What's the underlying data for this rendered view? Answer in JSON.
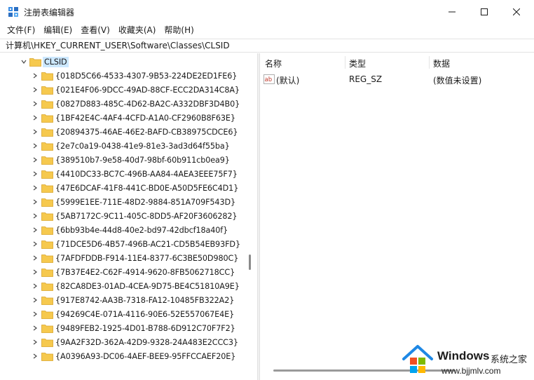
{
  "window": {
    "title": "注册表编辑器",
    "minimize_symbol": "─",
    "maximize_symbol": "☐",
    "close_symbol": "✕"
  },
  "menu": [
    {
      "label": "文件(F)"
    },
    {
      "label": "编辑(E)"
    },
    {
      "label": "查看(V)"
    },
    {
      "label": "收藏夹(A)"
    },
    {
      "label": "帮助(H)"
    }
  ],
  "address": {
    "path": "计算机\\HKEY_CURRENT_USER\\Software\\Classes\\CLSID"
  },
  "tree": {
    "selected": "CLSID",
    "items": [
      "{018D5C66-4533-4307-9B53-224DE2ED1FE6}",
      "{021E4F06-9DCC-49AD-88CF-ECC2DA314C8A}",
      "{0827D883-485C-4D62-BA2C-A332DBF3D4B0}",
      "{1BF42E4C-4AF4-4CFD-A1A0-CF2960B8F63E}",
      "{20894375-46AE-46E2-BAFD-CB38975CDCE6}",
      "{2e7c0a19-0438-41e9-81e3-3ad3d64f55ba}",
      "{389510b7-9e58-40d7-98bf-60b911cb0ea9}",
      "{4410DC33-BC7C-496B-AA84-4AEA3EEE75F7}",
      "{47E6DCAF-41F8-441C-BD0E-A50D5FE6C4D1}",
      "{5999E1EE-711E-48D2-9884-851A709F543D}",
      "{5AB7172C-9C11-405C-8DD5-AF20F3606282}",
      "{6bb93b4e-44d8-40e2-bd97-42dbcf18a40f}",
      "{71DCE5D6-4B57-496B-AC21-CD5B54EB93FD}",
      "{7AFDFDDB-F914-11E4-8377-6C3BE50D980C}",
      "{7B37E4E2-C62F-4914-9620-8FB5062718CC}",
      "{82CA8DE3-01AD-4CEA-9D75-BE4C51810A9E}",
      "{917E8742-AA3B-7318-FA12-10485FB322A2}",
      "{94269C4E-071A-4116-90E6-52E557067E4E}",
      "{9489FEB2-1925-4D01-B788-6D912C70F7F2}",
      "{9AA2F32D-362A-42D9-9328-24A483E2CCC3}",
      "{A0396A93-DC06-4AEF-BEE9-95FFCCAEF20E}"
    ]
  },
  "values": {
    "headers": {
      "name": "名称",
      "type": "类型",
      "data": "数据"
    },
    "rows": [
      {
        "name": "(默认)",
        "type": "REG_SZ",
        "data": "(数值未设置)"
      }
    ]
  },
  "watermark": {
    "brand": "Windows",
    "site_name": "系统之家",
    "url": "www.bjjmlv.com"
  },
  "colors": {
    "folder": "#f6c94e",
    "selection": "#cce8ff",
    "accent": "#0078d4"
  }
}
